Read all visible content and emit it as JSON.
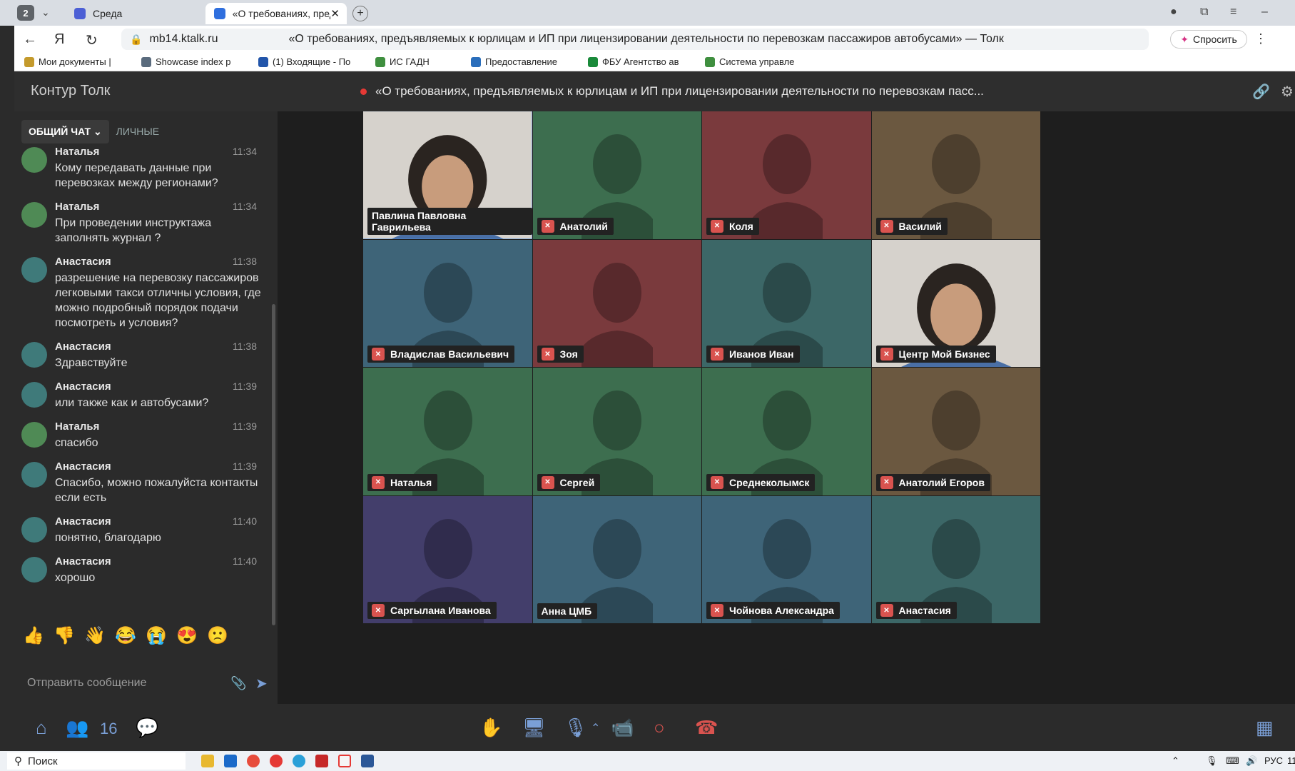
{
  "browser": {
    "tab_count": "2",
    "tabs": [
      {
        "label": "Среда"
      },
      {
        "label": "«О требованиях, предъ"
      }
    ],
    "url_host": "mb14.ktalk.ru",
    "page_title": "«О требованиях, предъявляемых к юрлицам и ИП при лицензировании деятельности по перевозкам пассажиров автобусами» — Толк",
    "ask_label": "Спросить",
    "bookmarks": [
      {
        "label": "Мои документы |"
      },
      {
        "label": "Showcase index p"
      },
      {
        "label": "(1) Входящие - По"
      },
      {
        "label": "ИС ГАДН"
      },
      {
        "label": "Предоставление"
      },
      {
        "label": "ФБУ Агентство ав"
      },
      {
        "label": "Система управле"
      }
    ]
  },
  "app": {
    "brand": "Контур Толк",
    "meeting_title": "«О требованиях, предъявляемых к юрлицам и ИП при лицензировании деятельности по перевозкам пасс..."
  },
  "chat": {
    "tab_common": "ОБЩИЙ ЧАТ",
    "tab_private": "ЛИЧНЫЕ",
    "messages": [
      {
        "name": "Наталья",
        "time": "11:34",
        "text": "Кому передавать данные при перевозках между регионами?"
      },
      {
        "name": "Наталья",
        "time": "11:34",
        "text": "При проведении инструктажа заполнять журнал ?"
      },
      {
        "name": "Анастасия",
        "time": "11:38",
        "text": "разрешение на перевозку пассажиров легковыми такси отличны условия, где можно подробный порядок подачи посмотреть и условия?"
      },
      {
        "name": "Анастасия",
        "time": "11:38",
        "text": "Здравствуйте"
      },
      {
        "name": "Анастасия",
        "time": "11:39",
        "text": "или также как и автобусами?"
      },
      {
        "name": "Наталья",
        "time": "11:39",
        "text": "спасибо"
      },
      {
        "name": "Анастасия",
        "time": "11:39",
        "text": "Спасибо, можно пожалуйста контакты если есть"
      },
      {
        "name": "Анастасия",
        "time": "11:40",
        "text": "понятно, благодарю"
      },
      {
        "name": "Анастасия",
        "time": "11:40",
        "text": "хорошо"
      }
    ],
    "reactions": [
      "👍",
      "👎",
      "👋",
      "😂",
      "😭",
      "😍",
      "🙁"
    ],
    "composer_placeholder": "Отправить сообщение"
  },
  "participants": [
    {
      "name": "Павлина Павловна Гаврильева",
      "muted": false,
      "video": true,
      "color": "#c9c4bd"
    },
    {
      "name": "Анатолий",
      "muted": true,
      "video": false,
      "color": "#3d6e4f"
    },
    {
      "name": "Коля",
      "muted": true,
      "video": false,
      "color": "#7a3a3d"
    },
    {
      "name": "Василий",
      "muted": true,
      "video": false,
      "color": "#6b5840"
    },
    {
      "name": "Владислав Васильевич",
      "muted": true,
      "video": false,
      "color": "#3e6478"
    },
    {
      "name": "Зоя",
      "muted": true,
      "video": false,
      "color": "#7a3a3d"
    },
    {
      "name": "Иванов Иван",
      "muted": true,
      "video": false,
      "color": "#3c6767"
    },
    {
      "name": "Центр Мой Бизнес",
      "muted": true,
      "video": true,
      "color": "#dcdcdc"
    },
    {
      "name": "Наталья",
      "muted": true,
      "video": false,
      "color": "#3d6e4f"
    },
    {
      "name": "Сергей",
      "muted": true,
      "video": false,
      "color": "#3d6e4f"
    },
    {
      "name": "Среднеколымск",
      "muted": true,
      "video": false,
      "color": "#3d6e4f"
    },
    {
      "name": "Анатолий Егоров",
      "muted": true,
      "video": false,
      "color": "#6b5840"
    },
    {
      "name": "Саргылана Иванова",
      "muted": true,
      "video": false,
      "color": "#433e6b"
    },
    {
      "name": "Анна ЦМБ",
      "muted": false,
      "video": false,
      "color": "#3e6478"
    },
    {
      "name": "Чойнова Александра",
      "muted": true,
      "video": false,
      "color": "#3e6478"
    },
    {
      "name": "Анастасия",
      "muted": true,
      "video": false,
      "color": "#3c6767"
    }
  ],
  "toolbar": {
    "participant_count": "16"
  },
  "taskbar": {
    "search_placeholder": "Поиск",
    "lang": "РУС",
    "clock": "11"
  },
  "colors": {
    "accent": "#7a9fd6",
    "record_dot": "#e53935",
    "mute_badge": "#d9534f"
  }
}
